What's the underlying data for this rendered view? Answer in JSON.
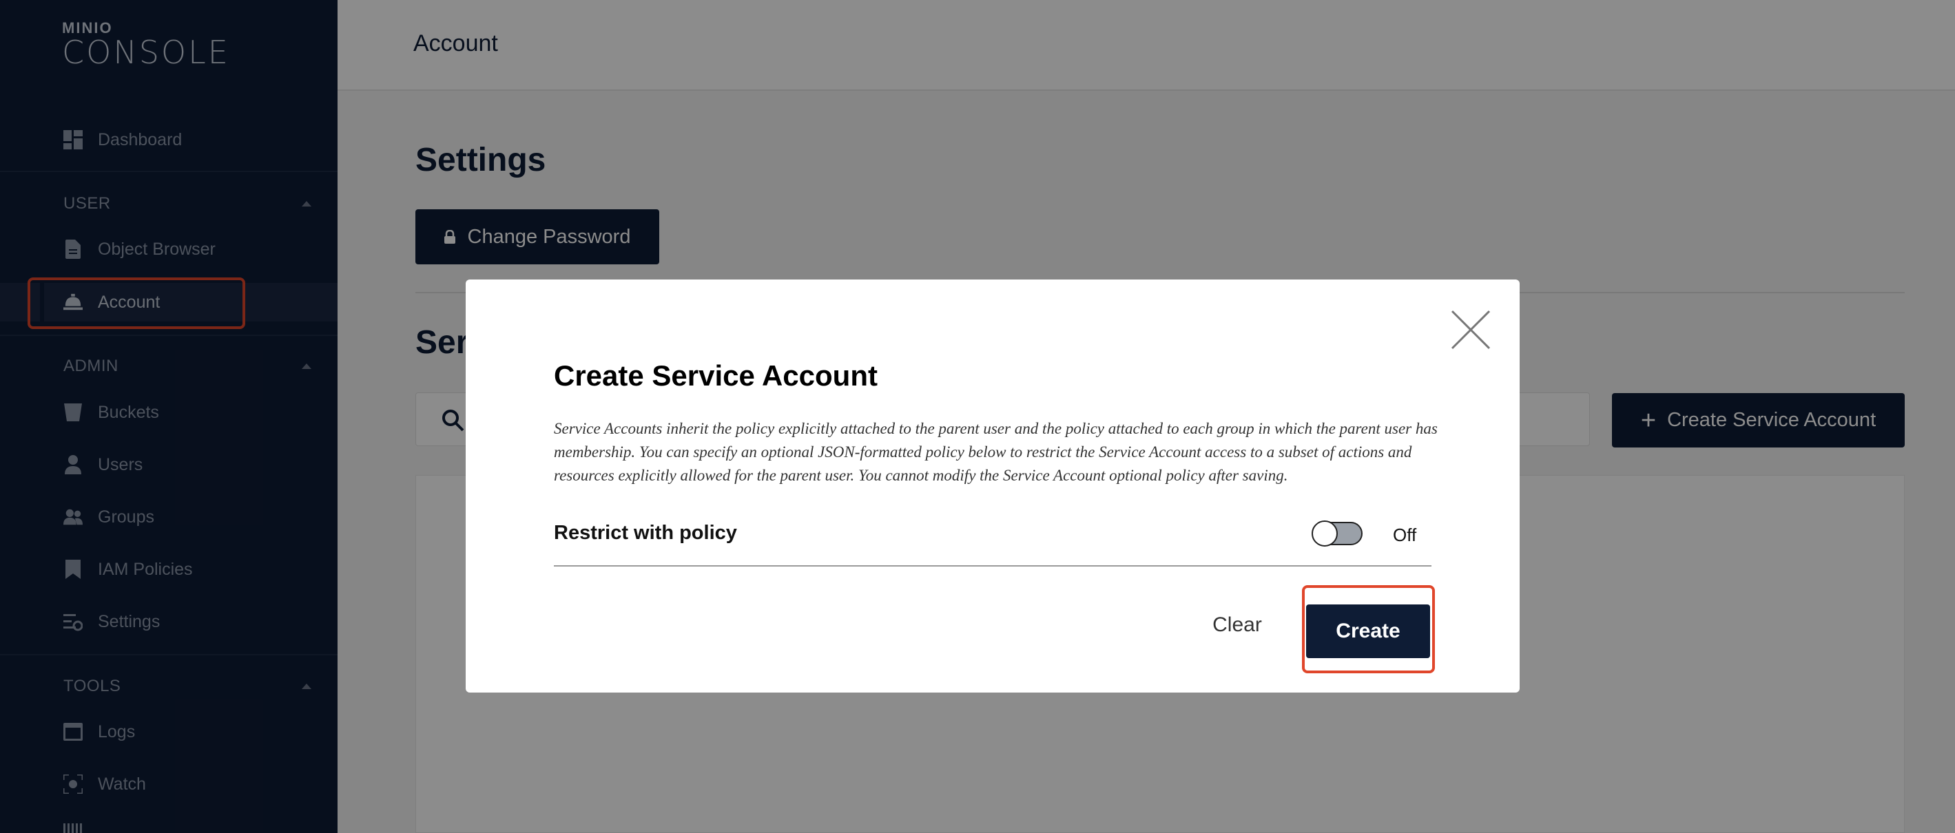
{
  "logo": {
    "brand_small": "MINIO",
    "brand_big": "CONSOLE"
  },
  "sidebar": {
    "dashboard": "Dashboard",
    "sections": [
      {
        "title": "USER",
        "items": [
          "Object Browser",
          "Account"
        ]
      },
      {
        "title": "ADMIN",
        "items": [
          "Buckets",
          "Users",
          "Groups",
          "IAM Policies",
          "Settings"
        ]
      },
      {
        "title": "TOOLS",
        "items": [
          "Logs",
          "Watch"
        ]
      }
    ],
    "active_item": "Account"
  },
  "topbar": {
    "title": "Account"
  },
  "page": {
    "settings_title": "Settings",
    "change_password": "Change Password",
    "section_partial": "Ser",
    "create_service_account": "Create Service Account"
  },
  "modal": {
    "title": "Create Service Account",
    "description": "Service Accounts inherit the policy explicitly attached to the parent user and the policy attached to each group in which the parent user has membership. You can specify an optional JSON-formatted policy below to restrict the Service Account access to a subset of actions and resources explicitly allowed for the parent user. You cannot modify the Service Account optional policy after saving.",
    "restrict_label": "Restrict with policy",
    "toggle_state": "Off",
    "clear_label": "Clear",
    "create_label": "Create"
  },
  "colors": {
    "sidebar_bg": "#0e1c35",
    "primary": "#0e1c35",
    "highlight": "#e0462b"
  }
}
